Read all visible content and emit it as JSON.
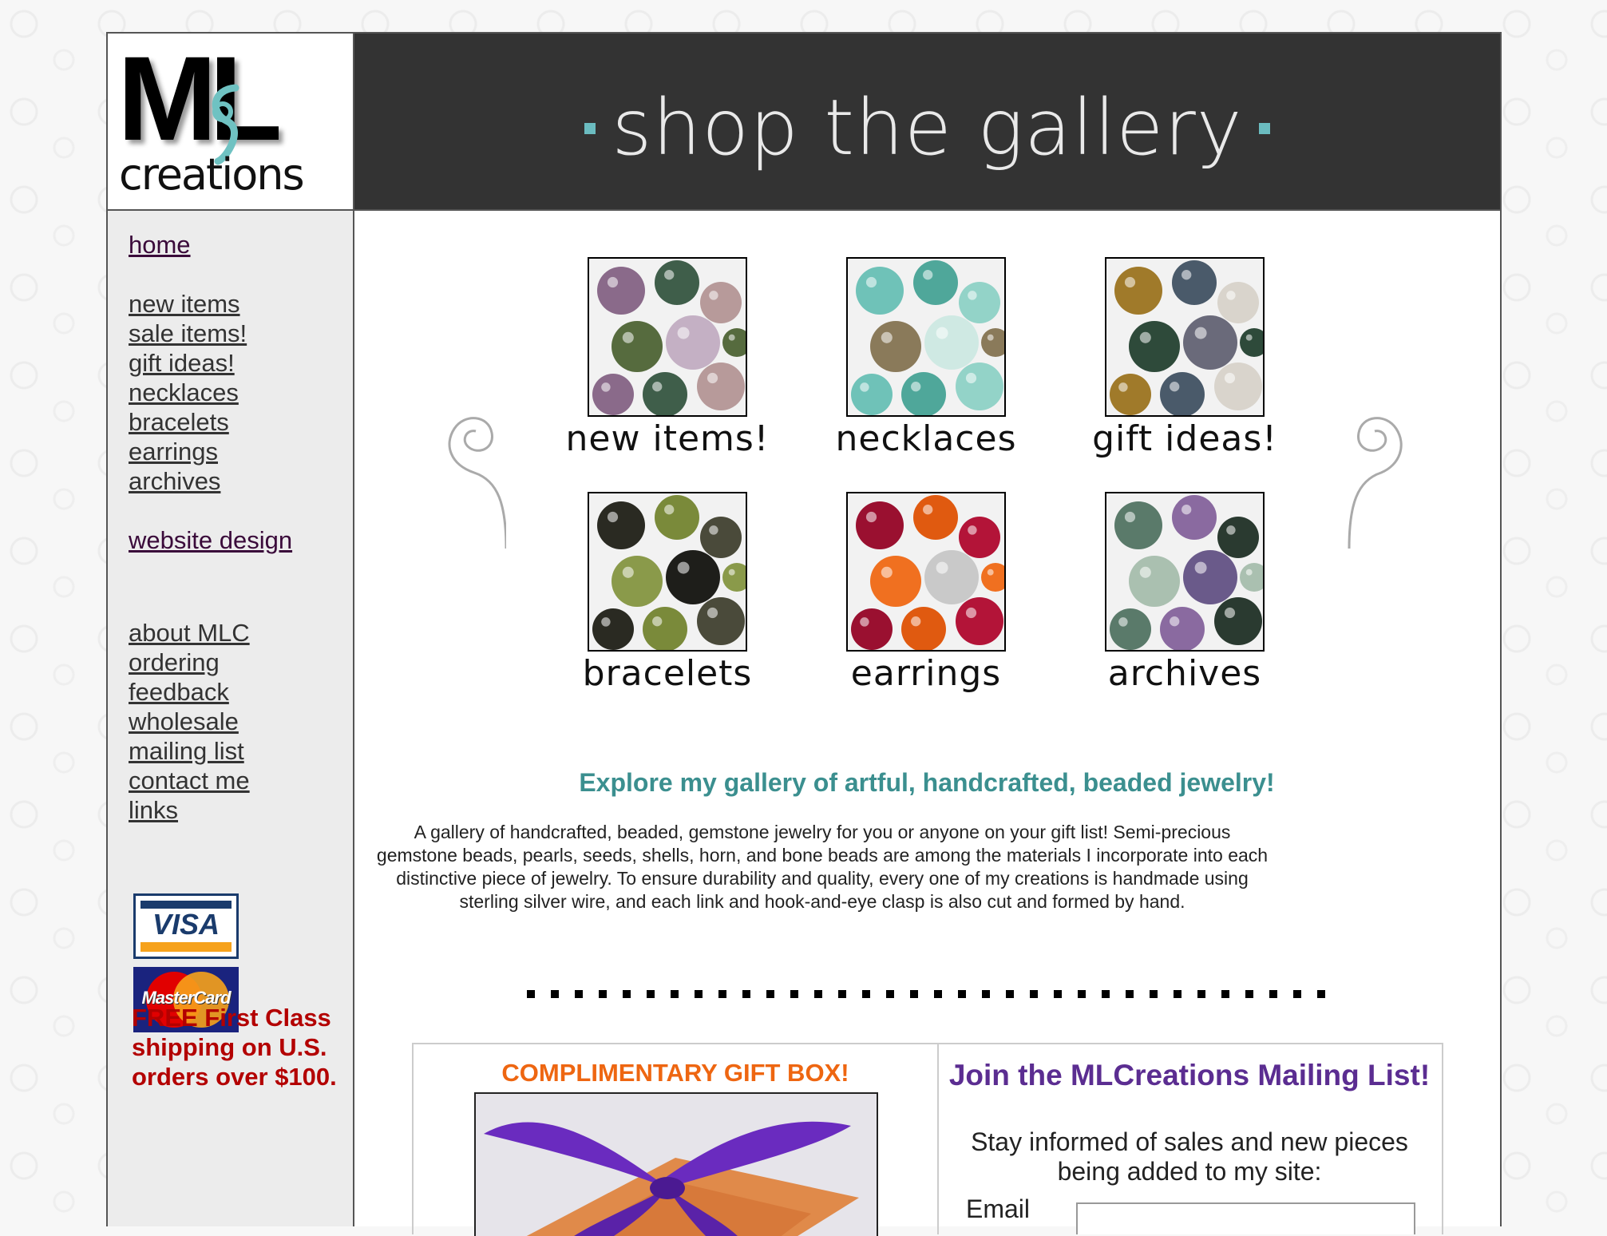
{
  "header": {
    "logo_letters": "ML",
    "logo_sub": "creations",
    "banner_title": "shop the gallery"
  },
  "sidebar": {
    "group1": [
      {
        "label": "home",
        "visited": true
      }
    ],
    "group2": [
      {
        "label": "new items"
      },
      {
        "label": "sale items!"
      },
      {
        "label": "gift ideas!"
      },
      {
        "label": "necklaces"
      },
      {
        "label": "bracelets"
      },
      {
        "label": "earrings"
      },
      {
        "label": "archives"
      }
    ],
    "group3": [
      {
        "label": "website design",
        "visited": true
      }
    ],
    "group4": [
      {
        "label": "about MLC"
      },
      {
        "label": "ordering"
      },
      {
        "label": "feedback"
      },
      {
        "label": "wholesale"
      },
      {
        "label": "mailing list"
      },
      {
        "label": "contact me"
      },
      {
        "label": "links"
      }
    ],
    "cards": {
      "visa": "VISA",
      "mastercard": "MasterCard"
    },
    "promo": "FREE First Class shipping on U.S. orders over $100."
  },
  "gallery": {
    "items": [
      {
        "caption": "new items!",
        "palette": [
          "#8a6a8a",
          "#3f5e4a",
          "#b79a9a",
          "#566b3e",
          "#c4b0c4"
        ]
      },
      {
        "caption": "necklaces",
        "palette": [
          "#6fc2b8",
          "#4fa79a",
          "#93d3c8",
          "#8a7a5a",
          "#cfe9e3"
        ]
      },
      {
        "caption": "gift ideas!",
        "palette": [
          "#a07a2a",
          "#4a5a6a",
          "#d9d4cc",
          "#2e4a3a",
          "#6a6a7a"
        ]
      },
      {
        "caption": "bracelets",
        "palette": [
          "#2a2a22",
          "#7a8a3a",
          "#4a4a3a",
          "#8a9a4a",
          "#1e1e1a"
        ]
      },
      {
        "caption": "earrings",
        "palette": [
          "#9a1030",
          "#e05a10",
          "#b31438",
          "#f07020",
          "#c9c9c9"
        ]
      },
      {
        "caption": "archives",
        "palette": [
          "#5a7a6a",
          "#8a6aa0",
          "#2a3a30",
          "#aac0b0",
          "#6a5a8a"
        ]
      }
    ]
  },
  "content": {
    "headline": "Explore my gallery of artful, handcrafted, beaded jewelry!",
    "intro": "A gallery of handcrafted, beaded, gemstone jewelry for you or anyone on your gift list! Semi-precious gemstone beads, pearls, seeds, shells, horn, and bone beads are among the materials I incorporate into each distinctive piece of jewelry. To ensure durability and quality, every one of my creations is handmade using sterling silver wire, and each link and hook-and-eye clasp is also cut and formed by hand."
  },
  "giftbox": {
    "title": "COMPLIMENTARY GIFT BOX!"
  },
  "mailing": {
    "title": "Join the MLCreations Mailing List!",
    "subtitle": "Stay informed of sales and new pieces being added to my site:",
    "email_label": "Email",
    "email_value": ""
  },
  "colors": {
    "accent_teal": "#3b8f8f",
    "promo_red": "#b30000",
    "gift_orange": "#ee6611",
    "mailing_purple": "#5b2d91",
    "banner_bg": "#333333"
  }
}
